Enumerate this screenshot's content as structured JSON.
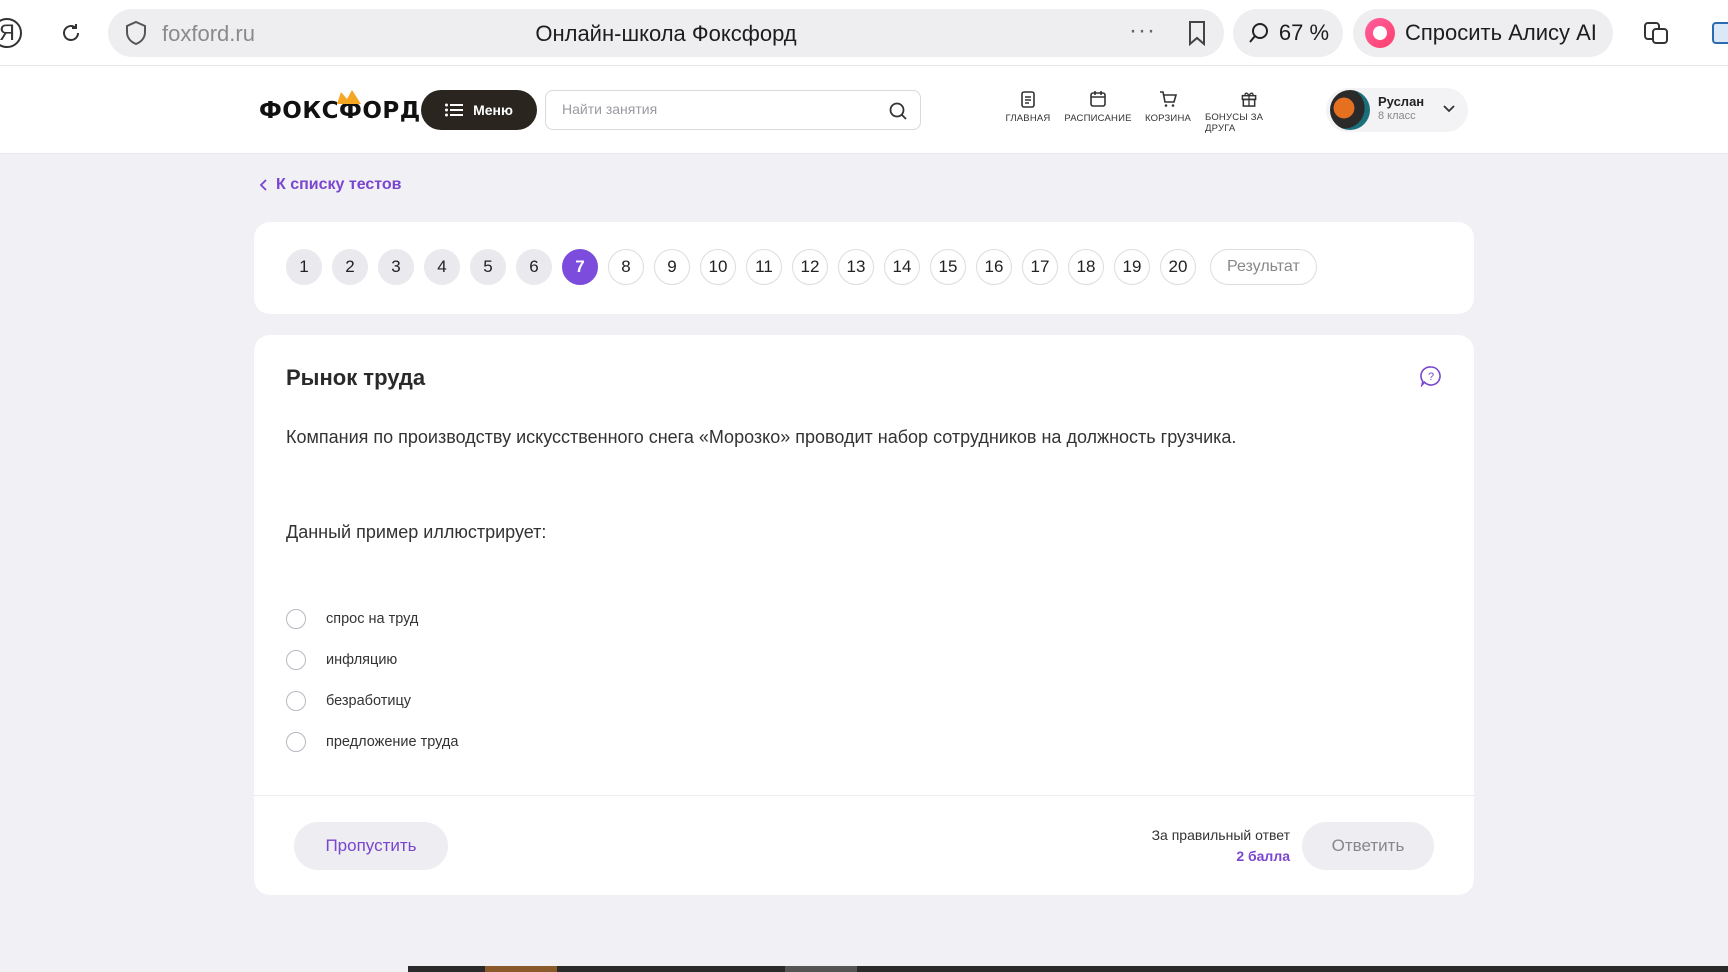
{
  "browser": {
    "url": "foxford.ru",
    "page_title": "Онлайн-школа Фоксфорд",
    "zoom": "67 %",
    "alice_label": "Спросить Алису AI",
    "yandex_glyph": "Я"
  },
  "header": {
    "logo": "ФОКСФОРД",
    "menu_label": "Меню",
    "search_placeholder": "Найти занятия",
    "nav": [
      {
        "label": "ГЛАВНАЯ",
        "icon": "clipboard-icon"
      },
      {
        "label": "РАСПИСАНИЕ",
        "icon": "calendar-icon"
      },
      {
        "label": "КОРЗИНА",
        "icon": "cart-icon"
      },
      {
        "label": "БОНУСЫ ЗА ДРУГА",
        "icon": "gift-icon"
      }
    ],
    "user": {
      "name": "Руслан",
      "grade": "8 класс"
    }
  },
  "back_link": "К списку тестов",
  "pager": {
    "pages": [
      "1",
      "2",
      "3",
      "4",
      "5",
      "6",
      "7",
      "8",
      "9",
      "10",
      "11",
      "12",
      "13",
      "14",
      "15",
      "16",
      "17",
      "18",
      "19",
      "20"
    ],
    "current": "7",
    "done_count": 6,
    "result_label": "Результат"
  },
  "question": {
    "title": "Рынок труда",
    "text": "Компания по производству искусственного снега «Морозко» проводит набор сотрудников на должность грузчика.",
    "prompt": "Данный пример иллюстрирует:",
    "options": [
      "спрос на труд",
      "инфляцию",
      "безработицу",
      "предложение труда"
    ]
  },
  "footer": {
    "skip_label": "Пропустить",
    "points_label": "За правильный ответ",
    "points_value": "2 балла",
    "answer_label": "Ответить"
  },
  "colors": {
    "accent": "#7c4ddc",
    "link": "#7a45cf",
    "dark_button": "#2b2520"
  }
}
